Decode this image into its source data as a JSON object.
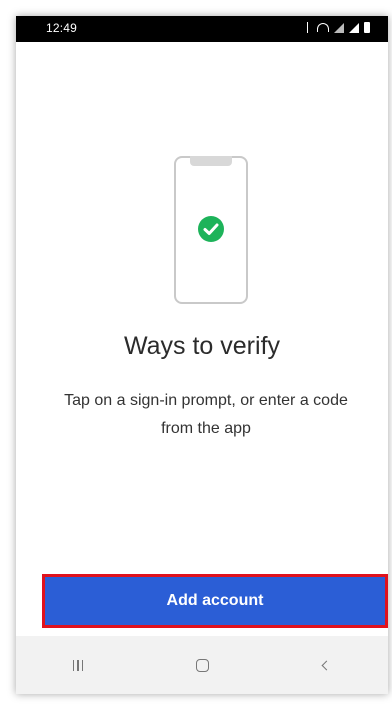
{
  "status_bar": {
    "time": "12:49",
    "icons": [
      "bluetooth-icon",
      "wifi-icon",
      "signal-icon",
      "signal-icon",
      "battery-icon"
    ]
  },
  "main": {
    "illustration": {
      "icon": "phone-check-icon",
      "check_color": "#1db35a"
    },
    "heading": "Ways to verify",
    "subtext": "Tap on a sign-in prompt, or enter a code from the app"
  },
  "primary_action": {
    "label": "Add account",
    "color": "#2b5ed6",
    "highlight_color": "#e0121d"
  },
  "nav_bar": {
    "buttons": [
      "recents-icon",
      "home-icon",
      "back-icon"
    ]
  }
}
